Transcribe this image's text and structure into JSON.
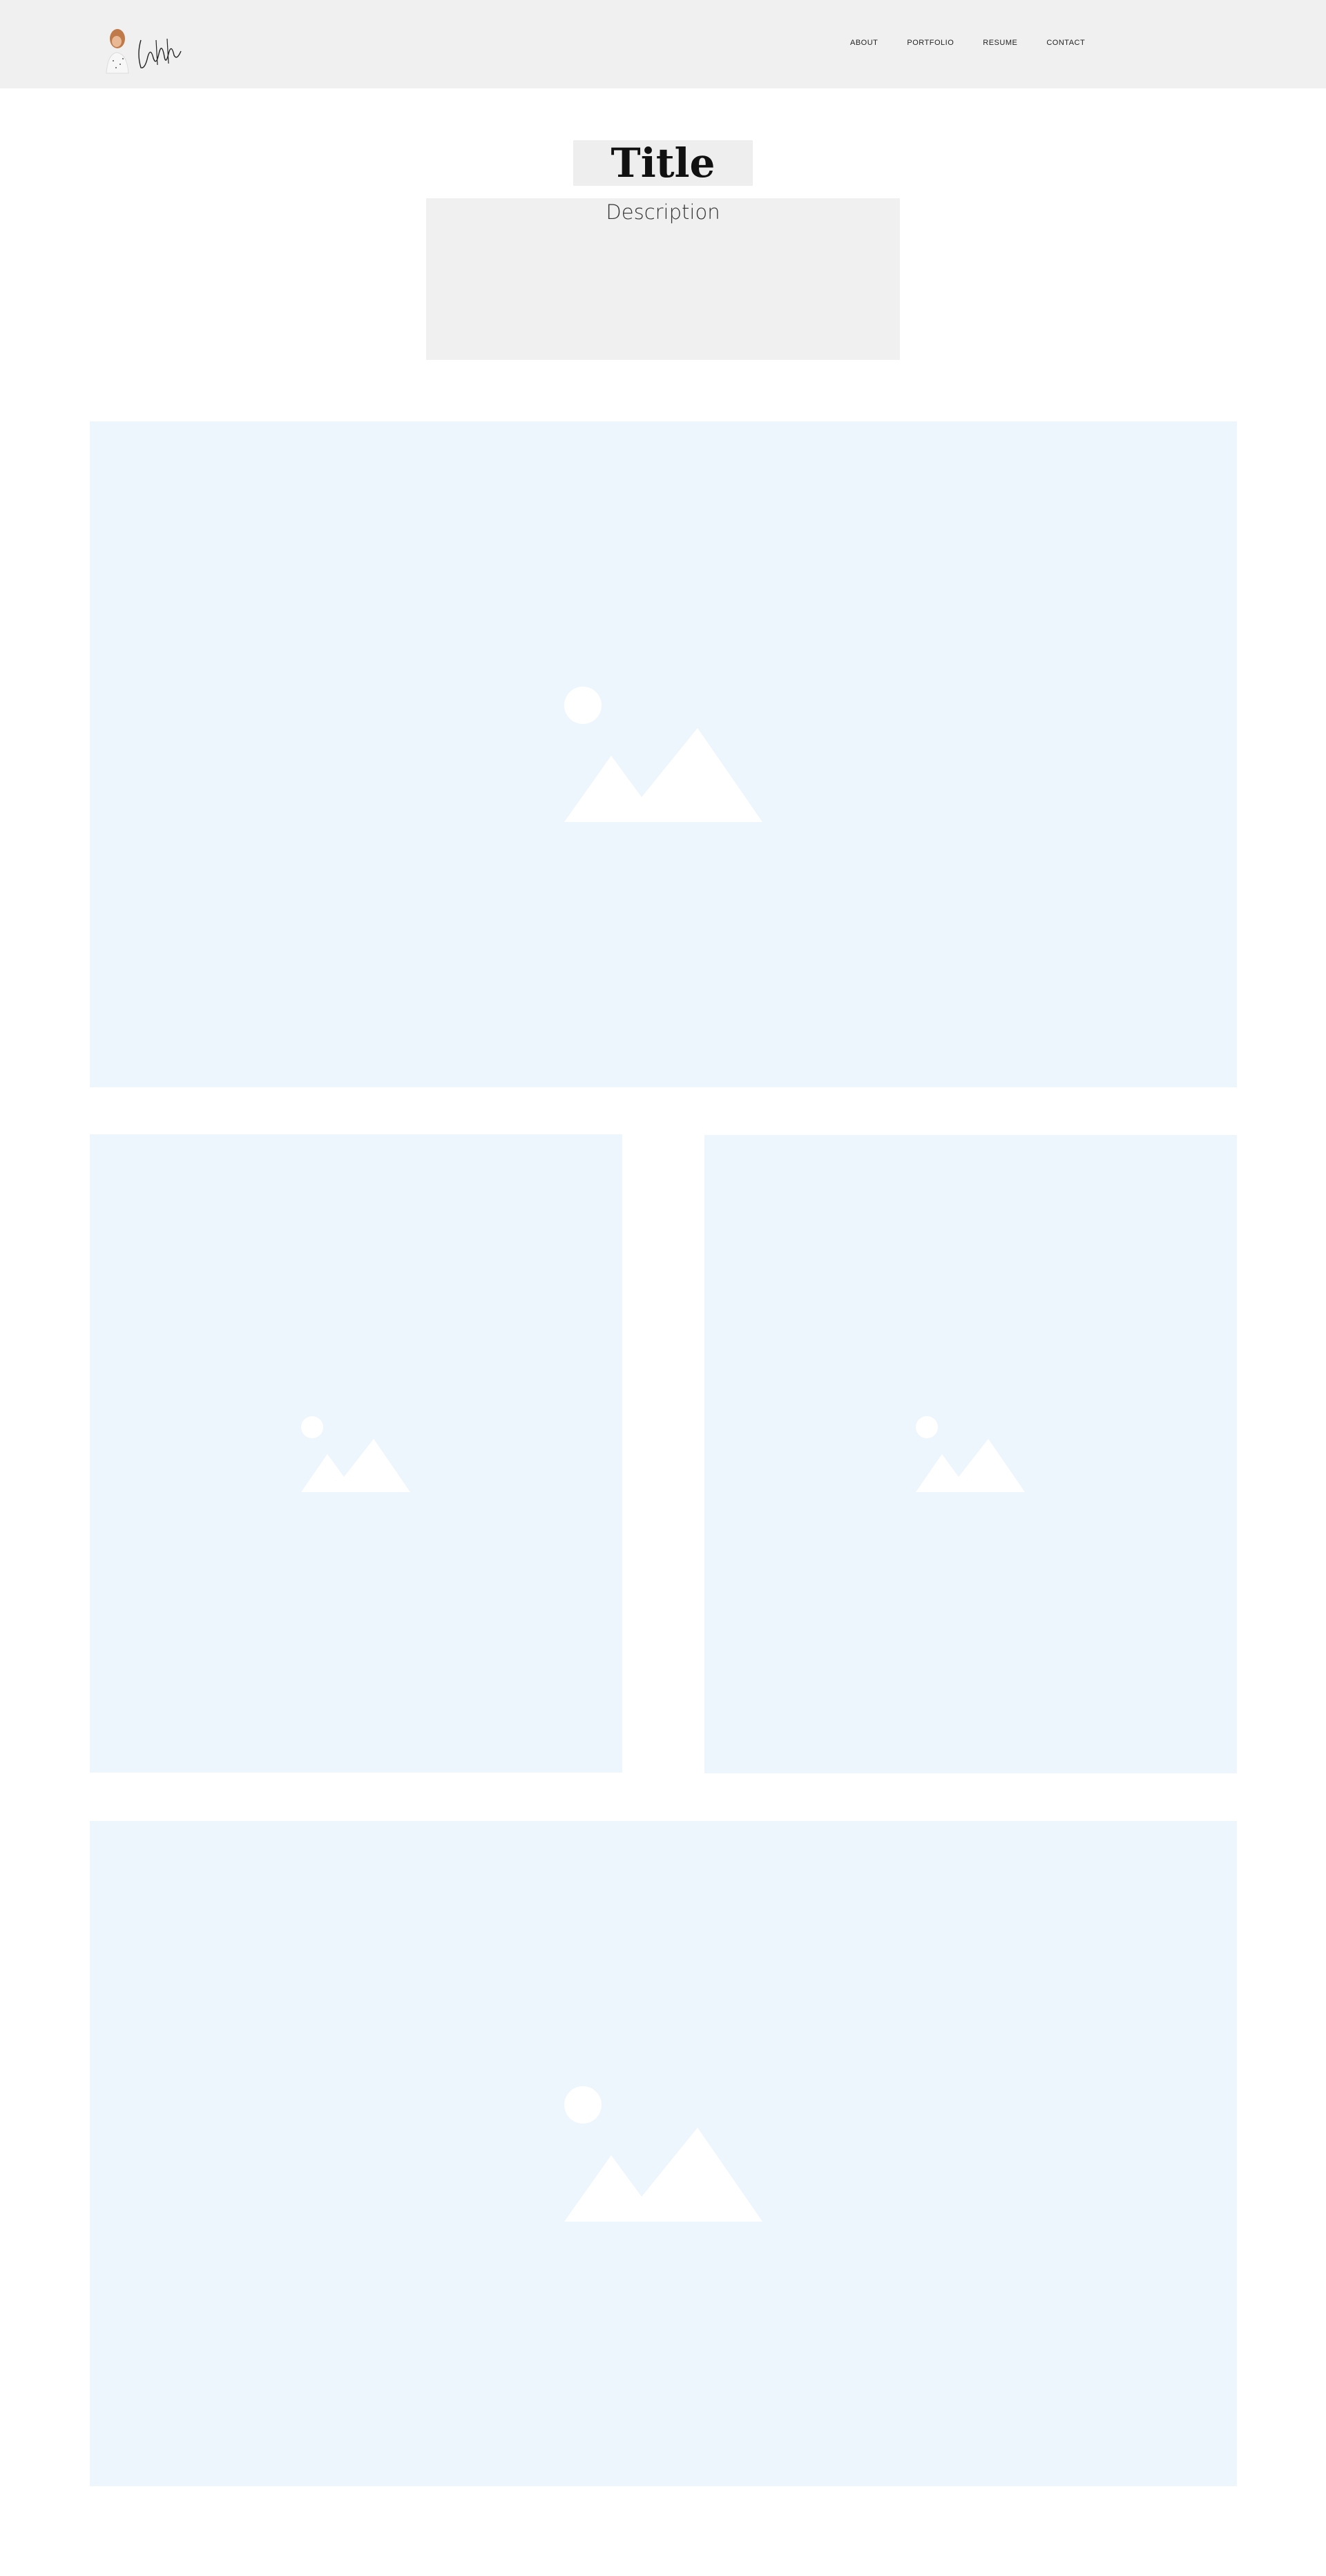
{
  "header": {
    "nav": [
      {
        "label": "ABOUT"
      },
      {
        "label": "PORTFOLIO"
      },
      {
        "label": "RESUME"
      },
      {
        "label": "CONTACT"
      }
    ]
  },
  "hero": {
    "title": "Title",
    "description": "Description"
  },
  "gallery": {
    "images": [
      {
        "icon": "image-placeholder-icon"
      },
      {
        "icon": "image-placeholder-icon"
      },
      {
        "icon": "image-placeholder-icon"
      },
      {
        "icon": "image-placeholder-icon"
      }
    ]
  },
  "colors": {
    "header_bg": "#f0f0f0",
    "placeholder_bg": "#eef6fd",
    "placeholder_icon": "#ffffff"
  }
}
